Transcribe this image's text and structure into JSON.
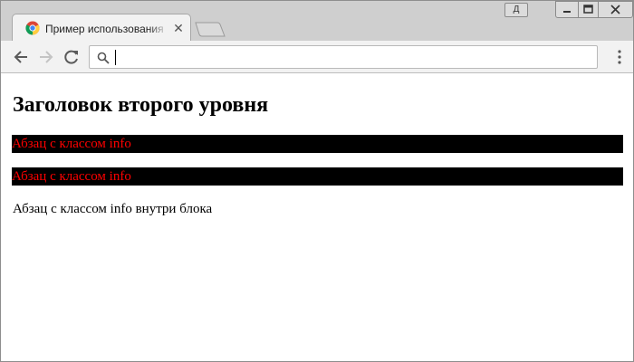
{
  "browser": {
    "tab": {
      "title": "Пример использования jQuery"
    },
    "user_button_label": "Д",
    "omnibox": {
      "value": ""
    }
  },
  "page": {
    "heading": "Заголовок второго уровня",
    "paragraphs": [
      {
        "text": "Абзац с классом info",
        "color": "#ff0000",
        "background": "#000000"
      },
      {
        "text": "Абзац с классом info",
        "color": "#ff0000",
        "background": "#000000"
      },
      {
        "text": "Абзац с классом info внутри блока",
        "color": "#000000",
        "background": "#ffffff"
      }
    ]
  },
  "icons": {
    "tab_favicon": "chrome-logo-icon",
    "tab_close": "close-icon",
    "back": "arrow-left-icon",
    "forward": "arrow-right-icon",
    "reload": "reload-icon",
    "search": "search-icon",
    "menu": "kebab-menu-icon",
    "minimize": "minimize-icon",
    "maximize": "maximize-icon",
    "close": "close-window-icon"
  },
  "colors": {
    "titlebar": "#cfcfcf",
    "toolbar": "#f2f2f2",
    "info_text": "#ff0000",
    "info_background": "#000000"
  }
}
